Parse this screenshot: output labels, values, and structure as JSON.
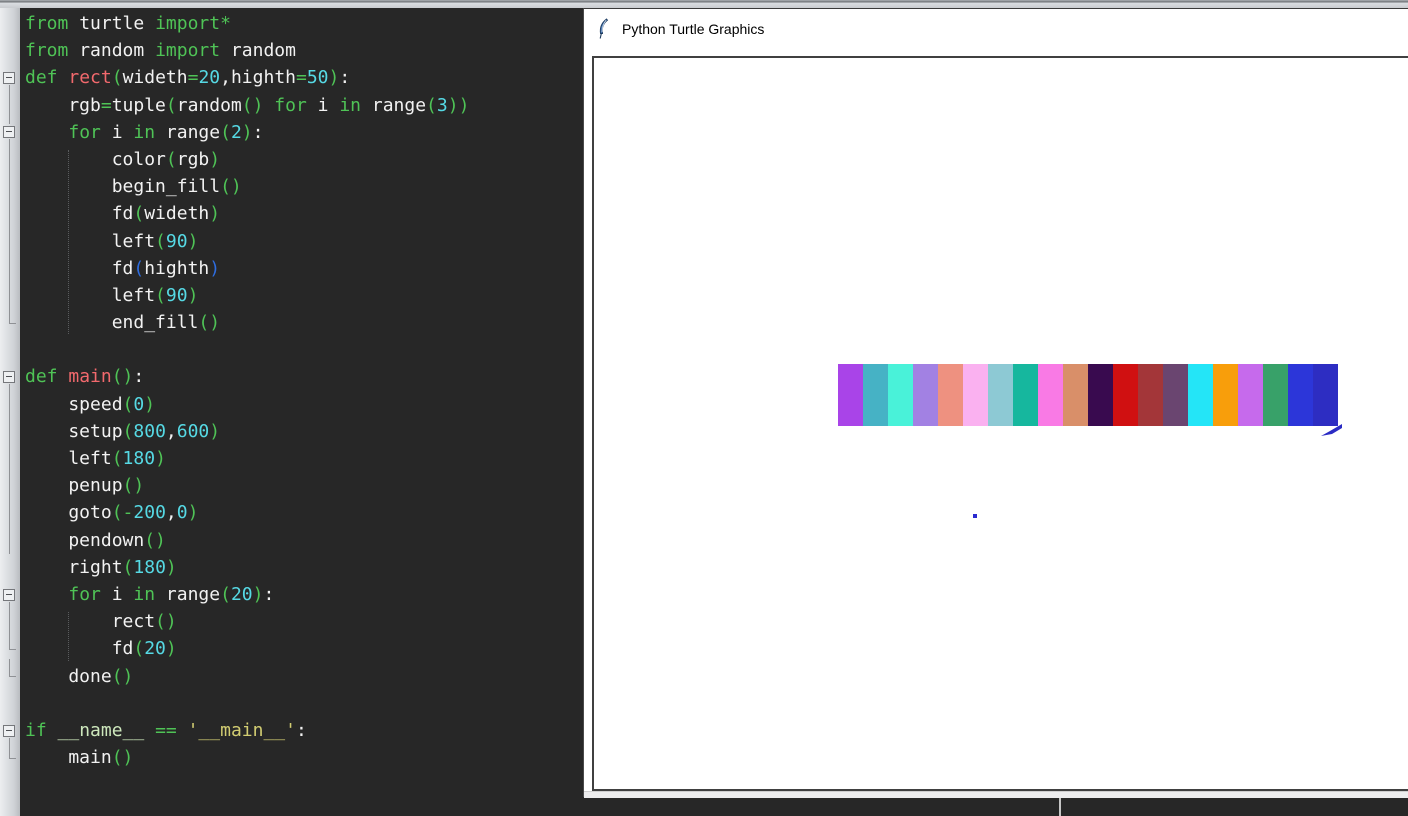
{
  "editor": {
    "background": "#272727",
    "palette": {
      "kw": "#4fc356",
      "fn": "#f2696d",
      "id": "#f2f2f2",
      "num": "#56d9e4",
      "str": "#d2cd72",
      "op": "#4fc356",
      "blue": "#2e6de0",
      "builtin": "#cde7bc"
    },
    "lines": [
      [
        [
          "from",
          "kw"
        ],
        [
          " turtle ",
          "id"
        ],
        [
          "import",
          "kw"
        ],
        [
          "*",
          "op"
        ]
      ],
      [
        [
          "from",
          "kw"
        ],
        [
          " random ",
          "id"
        ],
        [
          "import",
          "kw"
        ],
        [
          " random",
          "id"
        ]
      ],
      [
        [
          "def ",
          "kw"
        ],
        [
          "rect",
          "fn"
        ],
        [
          "(",
          "op"
        ],
        [
          "wideth",
          "id"
        ],
        [
          "=",
          "op"
        ],
        [
          "20",
          "num"
        ],
        [
          ",",
          "id"
        ],
        [
          "highth",
          "id"
        ],
        [
          "=",
          "op"
        ],
        [
          "50",
          "num"
        ],
        [
          ")",
          "op"
        ],
        [
          ":",
          "id"
        ]
      ],
      [
        [
          "    rgb",
          "id"
        ],
        [
          "=",
          "op"
        ],
        [
          "tuple",
          "id"
        ],
        [
          "(",
          "op"
        ],
        [
          "random",
          "id"
        ],
        [
          "()",
          "op"
        ],
        [
          " ",
          "id"
        ],
        [
          "for",
          "kw"
        ],
        [
          " i ",
          "id"
        ],
        [
          "in",
          "kw"
        ],
        [
          " range",
          "id"
        ],
        [
          "(",
          "op"
        ],
        [
          "3",
          "num"
        ],
        [
          "))",
          "op"
        ]
      ],
      [
        [
          "    ",
          "id"
        ],
        [
          "for",
          "kw"
        ],
        [
          " i ",
          "id"
        ],
        [
          "in",
          "kw"
        ],
        [
          " range",
          "id"
        ],
        [
          "(",
          "op"
        ],
        [
          "2",
          "num"
        ],
        [
          ")",
          "op"
        ],
        [
          ":",
          "id"
        ]
      ],
      [
        [
          "        color",
          "id"
        ],
        [
          "(",
          "op"
        ],
        [
          "rgb",
          "id"
        ],
        [
          ")",
          "op"
        ]
      ],
      [
        [
          "        begin_fill",
          "id"
        ],
        [
          "()",
          "op"
        ]
      ],
      [
        [
          "        fd",
          "id"
        ],
        [
          "(",
          "op"
        ],
        [
          "wideth",
          "id"
        ],
        [
          ")",
          "op"
        ]
      ],
      [
        [
          "        left",
          "id"
        ],
        [
          "(",
          "op"
        ],
        [
          "90",
          "num"
        ],
        [
          ")",
          "op"
        ]
      ],
      [
        [
          "        fd",
          "id"
        ],
        [
          "(",
          "blue"
        ],
        [
          "highth",
          "id"
        ],
        [
          ")",
          "blue"
        ]
      ],
      [
        [
          "        left",
          "id"
        ],
        [
          "(",
          "op"
        ],
        [
          "90",
          "num"
        ],
        [
          ")",
          "op"
        ]
      ],
      [
        [
          "        end_fill",
          "id"
        ],
        [
          "()",
          "op"
        ]
      ],
      [],
      [
        [
          "def ",
          "kw"
        ],
        [
          "main",
          "fn"
        ],
        [
          "()",
          "op"
        ],
        [
          ":",
          "id"
        ]
      ],
      [
        [
          "    speed",
          "id"
        ],
        [
          "(",
          "op"
        ],
        [
          "0",
          "num"
        ],
        [
          ")",
          "op"
        ]
      ],
      [
        [
          "    setup",
          "id"
        ],
        [
          "(",
          "op"
        ],
        [
          "800",
          "num"
        ],
        [
          ",",
          "id"
        ],
        [
          "600",
          "num"
        ],
        [
          ")",
          "op"
        ]
      ],
      [
        [
          "    left",
          "id"
        ],
        [
          "(",
          "op"
        ],
        [
          "180",
          "num"
        ],
        [
          ")",
          "op"
        ]
      ],
      [
        [
          "    penup",
          "id"
        ],
        [
          "()",
          "op"
        ]
      ],
      [
        [
          "    goto",
          "id"
        ],
        [
          "(",
          "op"
        ],
        [
          "-",
          "op"
        ],
        [
          "200",
          "num"
        ],
        [
          ",",
          "id"
        ],
        [
          "0",
          "num"
        ],
        [
          ")",
          "op"
        ]
      ],
      [
        [
          "    pendown",
          "id"
        ],
        [
          "()",
          "op"
        ]
      ],
      [
        [
          "    right",
          "id"
        ],
        [
          "(",
          "op"
        ],
        [
          "180",
          "num"
        ],
        [
          ")",
          "op"
        ]
      ],
      [
        [
          "    ",
          "id"
        ],
        [
          "for",
          "kw"
        ],
        [
          " i ",
          "id"
        ],
        [
          "in",
          "kw"
        ],
        [
          " range",
          "id"
        ],
        [
          "(",
          "op"
        ],
        [
          "20",
          "num"
        ],
        [
          ")",
          "op"
        ],
        [
          ":",
          "id"
        ]
      ],
      [
        [
          "        rect",
          "id"
        ],
        [
          "()",
          "op"
        ]
      ],
      [
        [
          "        fd",
          "id"
        ],
        [
          "(",
          "op"
        ],
        [
          "20",
          "num"
        ],
        [
          ")",
          "op"
        ]
      ],
      [
        [
          "    done",
          "id"
        ],
        [
          "()",
          "op"
        ]
      ],
      [],
      [
        [
          "if ",
          "kw"
        ],
        [
          "__name__",
          "builtin"
        ],
        [
          " ",
          "id"
        ],
        [
          "==",
          "op"
        ],
        [
          " ",
          "id"
        ],
        [
          "'__main__'",
          "str"
        ],
        [
          ":",
          "id"
        ]
      ],
      [
        [
          "    main",
          "id"
        ],
        [
          "()",
          "op"
        ]
      ]
    ],
    "fold": {
      "boxes": [
        3,
        5,
        14,
        22,
        27
      ],
      "segs": [
        [
          3,
          4.7,
          0
        ],
        [
          5,
          12,
          1
        ],
        [
          14,
          20.5,
          0
        ],
        [
          22,
          24,
          1
        ],
        [
          24.1,
          25,
          1
        ],
        [
          27,
          28,
          1
        ]
      ]
    },
    "indent_guides": [
      [
        6,
        12
      ],
      [
        23,
        24
      ]
    ]
  },
  "turtle_window": {
    "title": "Python Turtle Graphics",
    "icon": "tk-feather-icon",
    "canvas": {
      "bar_colors": [
        "#a944e8",
        "#46b2c5",
        "#49f2d9",
        "#a281e3",
        "#ee9180",
        "#fab1f0",
        "#8dc9d4",
        "#16b79e",
        "#f97ae5",
        "#d98f69",
        "#390a4f",
        "#d01011",
        "#a33639",
        "#6a4570",
        "#24e5f7",
        "#f89e0b",
        "#c66aec",
        "#38a169",
        "#2c36d9",
        "#2d2dc2"
      ],
      "turtle_cursor_color": "#2b2cc4",
      "pen_dot_color": "#2a2ad0"
    }
  }
}
